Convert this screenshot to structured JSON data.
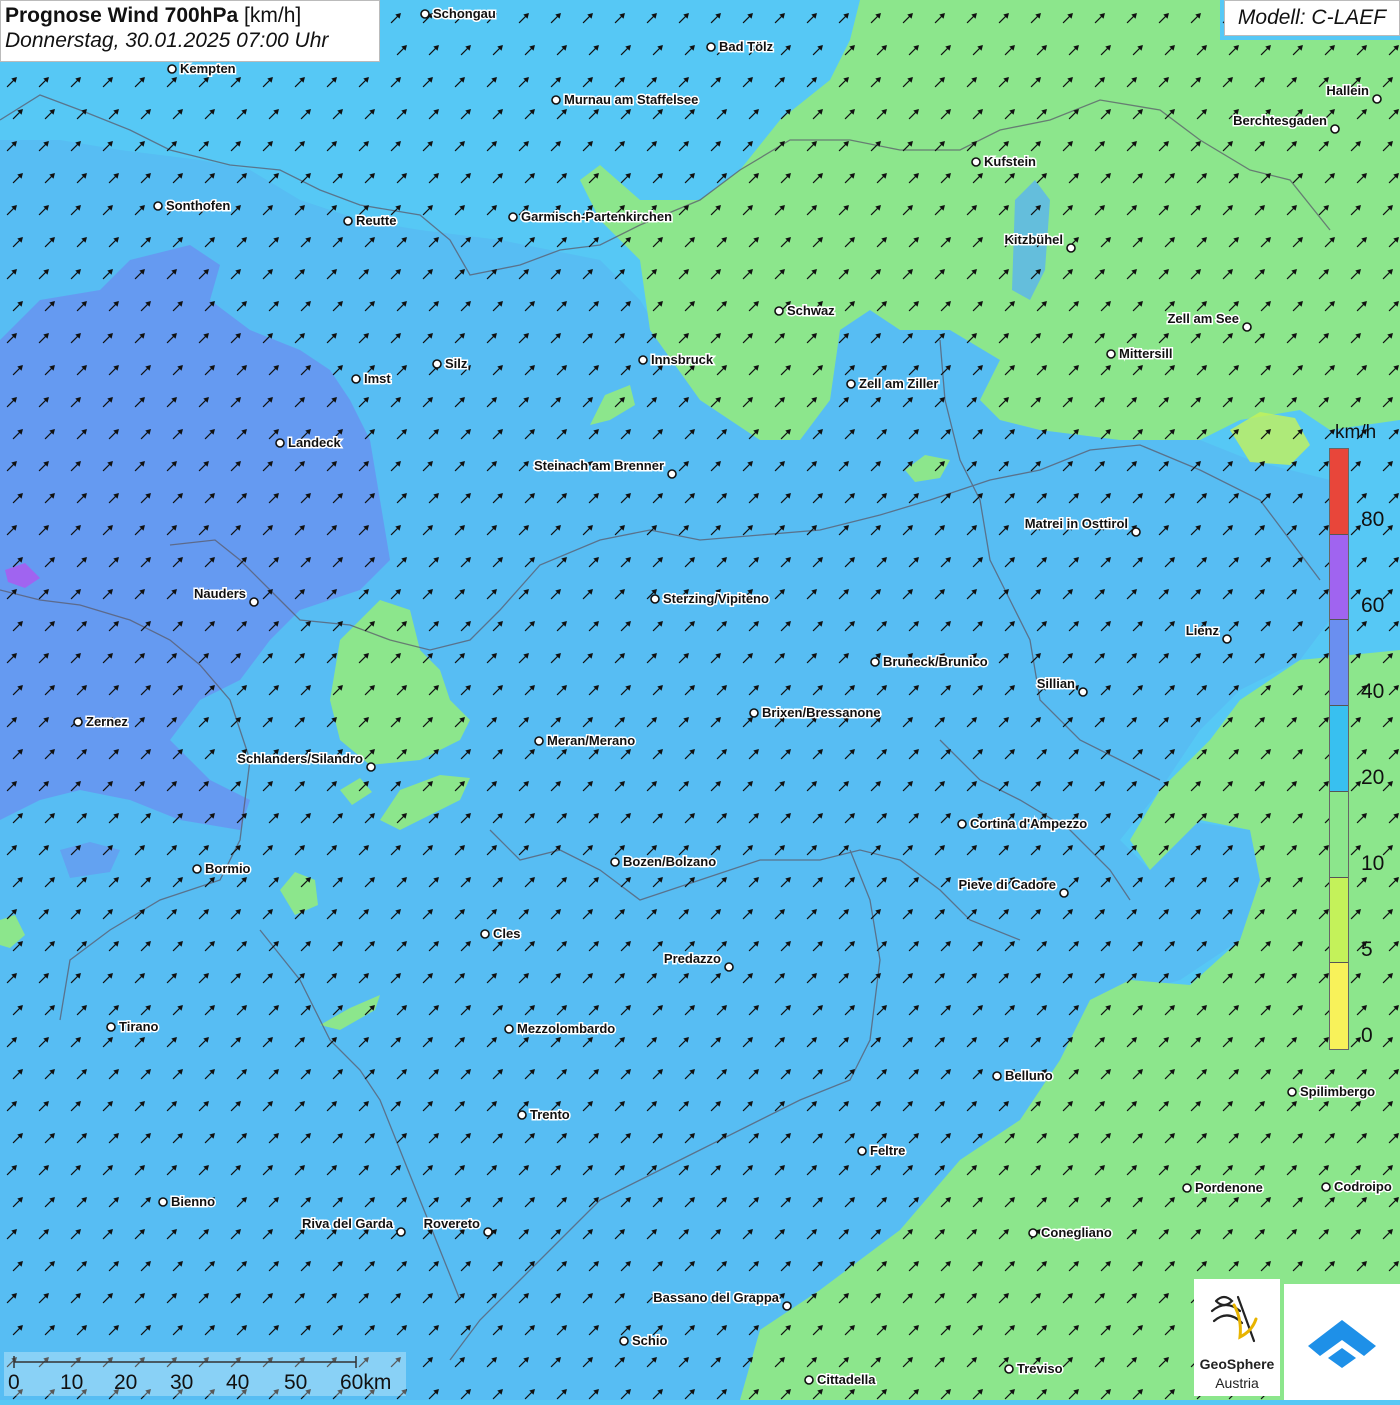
{
  "header": {
    "title_bold": "Prognose Wind 700hPa",
    "title_unit": "[km/h]",
    "datetime": "Donnerstag, 30.01.2025 07:00 Uhr",
    "model": "Modell: C-LAEF"
  },
  "legend": {
    "unit": "km/h",
    "ticks": [
      "80",
      "60",
      "40",
      "20",
      "10",
      "5",
      "0"
    ],
    "colors": [
      "#e8463a",
      "#a064f0",
      "#6a8ff0",
      "#38c0f0",
      "#8ce68c",
      "#c4f25a",
      "#f8f25a"
    ]
  },
  "scalebar": {
    "labels": [
      "0",
      "10",
      "20",
      "30",
      "40",
      "50",
      "60km"
    ]
  },
  "logos": {
    "geosphere_line1": "GeoSphere",
    "geosphere_line2": "Austria"
  },
  "cities": [
    {
      "name": "Schongau"
    },
    {
      "name": "Bad Tölz"
    },
    {
      "name": "Kempten"
    },
    {
      "name": "Murnau am Staffelsee"
    },
    {
      "name": "Hallein"
    },
    {
      "name": "Berchtesgaden"
    },
    {
      "name": "Kufstein"
    },
    {
      "name": "Sonthofen"
    },
    {
      "name": "Reutte"
    },
    {
      "name": "Garmisch-Partenkirchen"
    },
    {
      "name": "Kitzbühel"
    },
    {
      "name": "Schwaz"
    },
    {
      "name": "Zell am See"
    },
    {
      "name": "Mittersill"
    },
    {
      "name": "Innsbruck"
    },
    {
      "name": "Silz"
    },
    {
      "name": "Imst"
    },
    {
      "name": "Zell am Ziller"
    },
    {
      "name": "Landeck"
    },
    {
      "name": "Steinach am Brenner"
    },
    {
      "name": "Matrei in Osttirol"
    },
    {
      "name": "Nauders"
    },
    {
      "name": "Sterzing/Vipiteno"
    },
    {
      "name": "Lienz"
    },
    {
      "name": "Bruneck/Brunico"
    },
    {
      "name": "Sillian"
    },
    {
      "name": "Zernez"
    },
    {
      "name": "Brixen/Bressanone"
    },
    {
      "name": "Meran/Merano"
    },
    {
      "name": "Schlanders/Silandro"
    },
    {
      "name": "Cortina d'Ampezzo"
    },
    {
      "name": "Bormio"
    },
    {
      "name": "Bozen/Bolzano"
    },
    {
      "name": "Pieve di Cadore"
    },
    {
      "name": "Cles"
    },
    {
      "name": "Predazzo"
    },
    {
      "name": "Tirano"
    },
    {
      "name": "Mezzolombardo"
    },
    {
      "name": "Belluno"
    },
    {
      "name": "Spilimbergo"
    },
    {
      "name": "Trento"
    },
    {
      "name": "Feltre"
    },
    {
      "name": "Bienno"
    },
    {
      "name": "Pordenone"
    },
    {
      "name": "Codroipo"
    },
    {
      "name": "Riva del Garda"
    },
    {
      "name": "Rovereto"
    },
    {
      "name": "Conegliano"
    },
    {
      "name": "Bassano del Grappa"
    },
    {
      "name": "Schio"
    },
    {
      "name": "Treviso"
    },
    {
      "name": "Cittadella"
    }
  ]
}
